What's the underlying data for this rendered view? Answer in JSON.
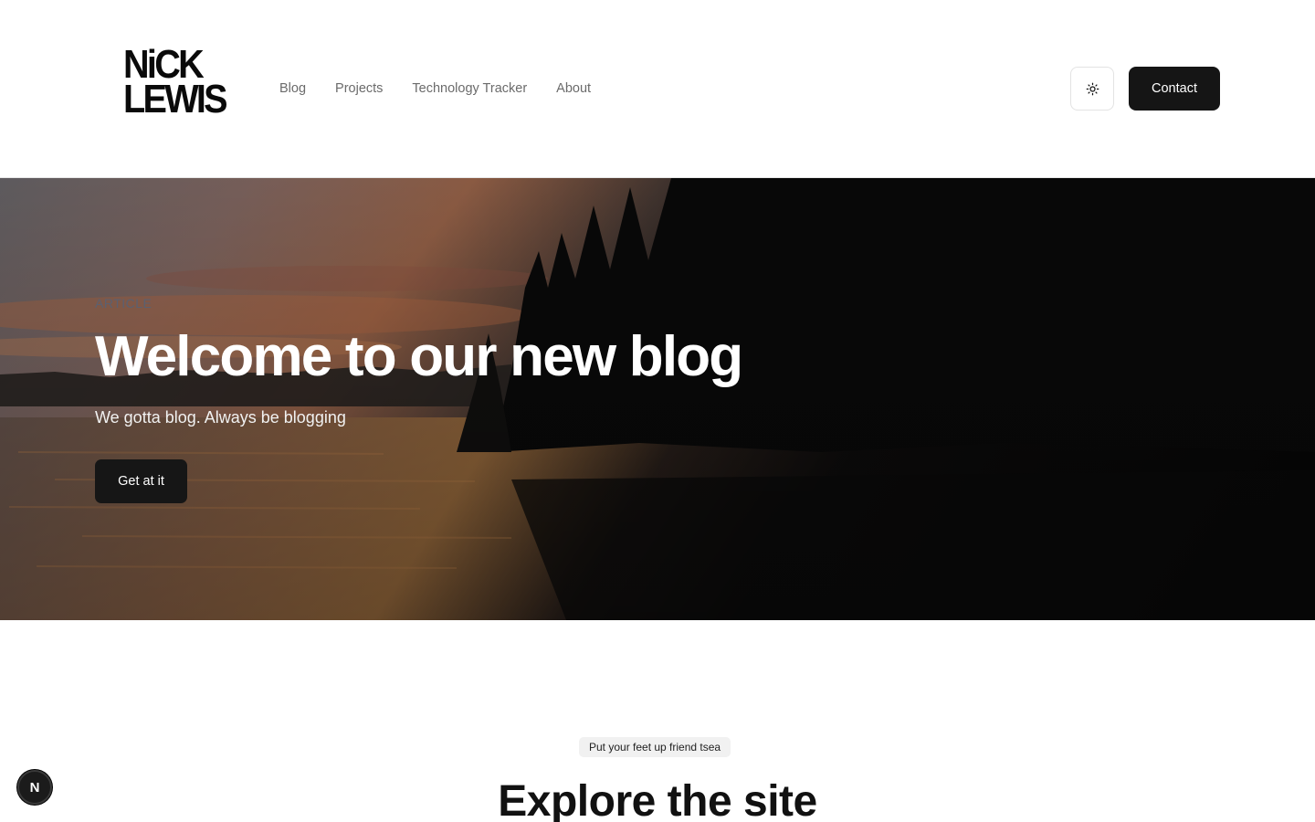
{
  "header": {
    "logo_line1": "NiCK",
    "logo_line2": "LEWIS",
    "nav": [
      "Blog",
      "Projects",
      "Technology Tracker",
      "About"
    ],
    "theme_icon": "sun-icon",
    "contact_label": "Contact"
  },
  "hero": {
    "eyebrow": "ARTICLE",
    "title": "Welcome to our new blog",
    "subtitle": "We gotta blog. Always be blogging",
    "button_label": "Get at it"
  },
  "section": {
    "badge": "Put your feet up friend tsea",
    "title": "Explore the site"
  },
  "devtools": {
    "label": "N",
    "icon": "nextjs-logo-icon"
  },
  "colors": {
    "primary_button": "#151515",
    "nav_text": "#6b6b6b",
    "badge_bg": "#f1f1f1"
  }
}
